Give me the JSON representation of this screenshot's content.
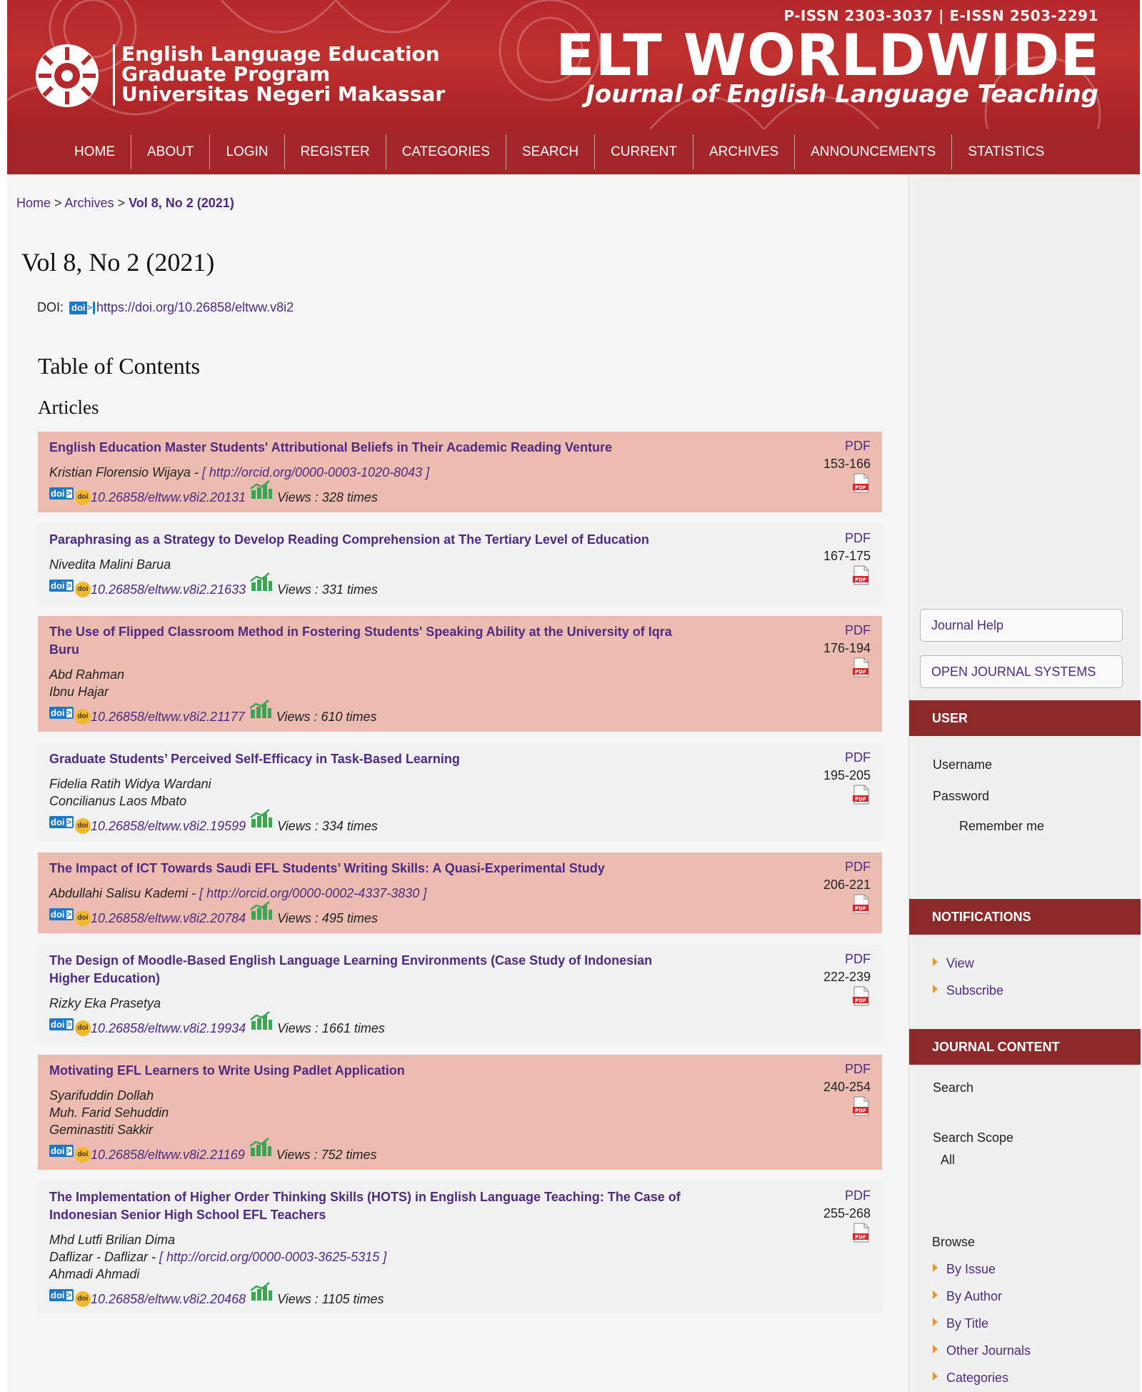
{
  "header": {
    "issn": "P-ISSN 2303-3037 | E-ISSN 2503-2291",
    "program_lines": [
      "English Language Education",
      "Graduate Program",
      "Universitas Negeri Makassar"
    ],
    "journal_title": "ELT WORLDWIDE",
    "journal_subtitle": "Journal of English Language Teaching"
  },
  "nav": [
    "HOME",
    "ABOUT",
    "LOGIN",
    "REGISTER",
    "CATEGORIES",
    "SEARCH",
    "CURRENT",
    "ARCHIVES",
    "ANNOUNCEMENTS",
    "STATISTICS"
  ],
  "breadcrumb": {
    "home": "Home",
    "sep1": " > ",
    "archives": "Archives",
    "sep2": " > ",
    "current": "Vol 8, No 2 (2021)"
  },
  "page_title": "Vol 8, No 2 (2021)",
  "doi": {
    "label": "DOI:",
    "badge": "doi",
    "url": "https://doi.org/10.26858/eltww.v8i2"
  },
  "toc_title": "Table of Contents",
  "section_title": "Articles",
  "articles": [
    {
      "title": "English Education Master Students' Attributional Beliefs in Their Academic Reading Venture",
      "authors": [
        {
          "name": "Kristian Florensio Wijaya",
          "orcid": "[ http://orcid.org/0000-0003-1020-8043 ]"
        }
      ],
      "doi": "10.26858/eltww.v8i2.20131",
      "views": "Views : 328 times",
      "pdf": "PDF",
      "pages": "153-166"
    },
    {
      "title": "Paraphrasing as a Strategy to Develop Reading Comprehension at The Tertiary Level of Education",
      "authors": [
        {
          "name": "Nivedita Malini Barua",
          "orcid": ""
        }
      ],
      "doi": "10.26858/eltww.v8i2.21633",
      "views": "Views : 331 times",
      "pdf": "PDF",
      "pages": "167-175"
    },
    {
      "title": "The Use of Flipped Classroom Method in Fostering Students' Speaking Ability at the University of Iqra Buru",
      "authors": [
        {
          "name": "Abd Rahman",
          "orcid": ""
        },
        {
          "name": "Ibnu Hajar",
          "orcid": ""
        }
      ],
      "doi": "10.26858/eltww.v8i2.21177",
      "views": "Views : 610 times",
      "pdf": "PDF",
      "pages": "176-194"
    },
    {
      "title": "Graduate Students’ Perceived Self-Efficacy in Task-Based Learning",
      "authors": [
        {
          "name": "Fidelia Ratih Widya Wardani",
          "orcid": ""
        },
        {
          "name": "Concilianus Laos Mbato",
          "orcid": ""
        }
      ],
      "doi": "10.26858/eltww.v8i2.19599",
      "views": "Views : 334 times",
      "pdf": "PDF",
      "pages": "195-205"
    },
    {
      "title": "The Impact of ICT Towards Saudi EFL Students’ Writing Skills: A Quasi-Experimental Study",
      "authors": [
        {
          "name": "Abdullahi Salisu Kademi",
          "orcid": "[ http://orcid.org/0000-0002-4337-3830 ]"
        }
      ],
      "doi": "10.26858/eltww.v8i2.20784",
      "views": "Views : 495 times",
      "pdf": "PDF",
      "pages": "206-221"
    },
    {
      "title": "The Design of Moodle-Based English Language Learning Environments (Case Study of Indonesian Higher Education)",
      "authors": [
        {
          "name": "Rizky Eka Prasetya",
          "orcid": ""
        }
      ],
      "doi": "10.26858/eltww.v8i2.19934",
      "views": "Views : 1661 times",
      "pdf": "PDF",
      "pages": "222-239"
    },
    {
      "title": "Motivating EFL Learners to Write Using Padlet Application",
      "authors": [
        {
          "name": "Syarifuddin Dollah",
          "orcid": ""
        },
        {
          "name": "Muh. Farid Sehuddin",
          "orcid": ""
        },
        {
          "name": "Geminastiti Sakkir",
          "orcid": ""
        }
      ],
      "doi": "10.26858/eltww.v8i2.21169",
      "views": "Views : 752 times",
      "pdf": "PDF",
      "pages": "240-254"
    },
    {
      "title": "The Implementation of Higher Order Thinking Skills (HOTS) in English Language Teaching: The Case of Indonesian Senior High School EFL Teachers",
      "authors": [
        {
          "name": "Mhd Lutfi Brilian Dima",
          "orcid": ""
        },
        {
          "name": "Daflizar - Daflizar",
          "orcid": "[ http://orcid.org/0000-0003-3625-5315 ]"
        },
        {
          "name": "Ahmadi Ahmadi",
          "orcid": ""
        }
      ],
      "doi": "10.26858/eltww.v8i2.20468",
      "views": "Views : 1105 times",
      "pdf": "PDF",
      "pages": "255-268"
    }
  ],
  "sidebar": {
    "journal_help": "Journal Help",
    "ojs": "OPEN JOURNAL SYSTEMS",
    "user_head": "USER",
    "username": "Username",
    "password": "Password",
    "remember": "Remember me",
    "notif_head": "NOTIFICATIONS",
    "notif_links": [
      "View",
      "Subscribe"
    ],
    "content_head": "JOURNAL CONTENT",
    "search": "Search",
    "scope": "Search Scope",
    "scope_value": "All",
    "browse": "Browse",
    "browse_links": [
      "By Issue",
      "By Author",
      "By Title",
      "Other Journals",
      "Categories"
    ]
  },
  "colors": {
    "header_red": "#b5282b",
    "nav_red": "#a4262a",
    "sidebar_head": "#8c2a2a",
    "link": "#4f2a85",
    "alt_row": "#edbcb0"
  }
}
